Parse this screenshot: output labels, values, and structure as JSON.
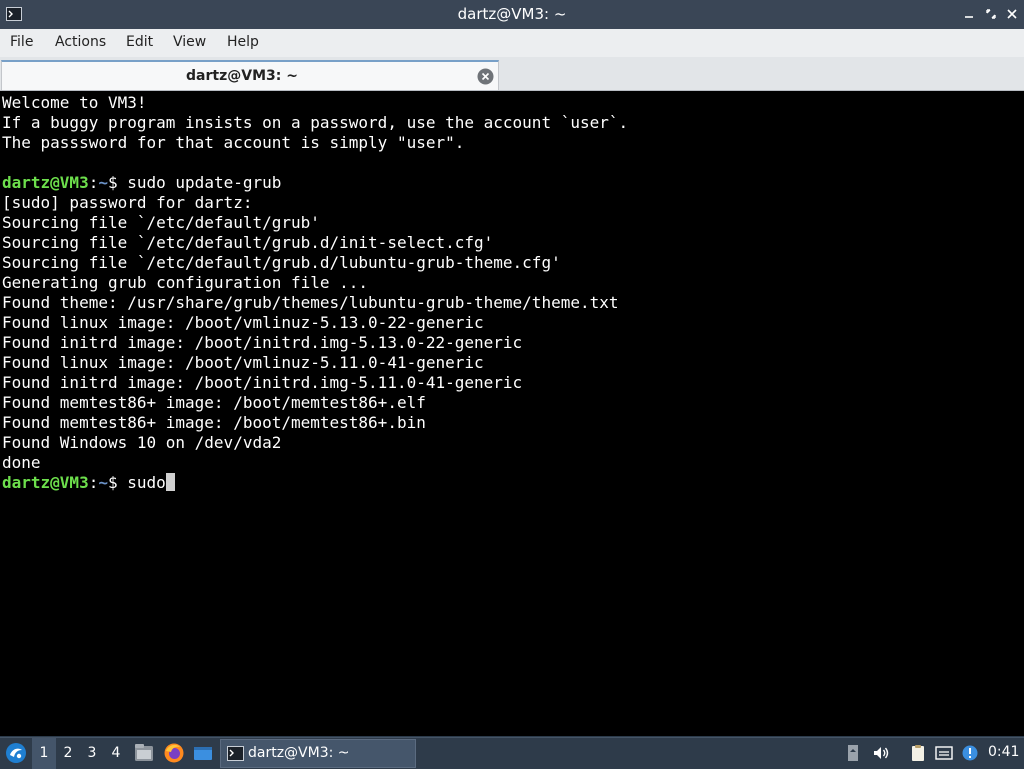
{
  "window": {
    "title": "dartz@VM3: ~"
  },
  "menu": [
    "File",
    "Actions",
    "Edit",
    "View",
    "Help"
  ],
  "tab": {
    "label": "dartz@VM3: ~"
  },
  "terminal": {
    "lines": [
      {
        "text": "Welcome to VM3!"
      },
      {
        "text": "If a buggy program insists on a password, use the account `user`."
      },
      {
        "text": "The passsword for that account is simply \"user\"."
      },
      {
        "text": ""
      },
      {
        "user": "dartz@VM3",
        "path": "~",
        "command": "sudo update-grub"
      },
      {
        "text": "[sudo] password for dartz:"
      },
      {
        "text": "Sourcing file `/etc/default/grub'"
      },
      {
        "text": "Sourcing file `/etc/default/grub.d/init-select.cfg'"
      },
      {
        "text": "Sourcing file `/etc/default/grub.d/lubuntu-grub-theme.cfg'"
      },
      {
        "text": "Generating grub configuration file ..."
      },
      {
        "text": "Found theme: /usr/share/grub/themes/lubuntu-grub-theme/theme.txt"
      },
      {
        "text": "Found linux image: /boot/vmlinuz-5.13.0-22-generic"
      },
      {
        "text": "Found initrd image: /boot/initrd.img-5.13.0-22-generic"
      },
      {
        "text": "Found linux image: /boot/vmlinuz-5.11.0-41-generic"
      },
      {
        "text": "Found initrd image: /boot/initrd.img-5.11.0-41-generic"
      },
      {
        "text": "Found memtest86+ image: /boot/memtest86+.elf"
      },
      {
        "text": "Found memtest86+ image: /boot/memtest86+.bin"
      },
      {
        "text": "Found Windows 10 on /dev/vda2"
      },
      {
        "text": "done"
      },
      {
        "user": "dartz@VM3",
        "path": "~",
        "command": "sudo",
        "cursor": true
      }
    ]
  },
  "taskbar": {
    "workspaces": [
      "1",
      "2",
      "3",
      "4"
    ],
    "active_workspace": "1",
    "task_label": "dartz@VM3: ~",
    "clock": "0:41"
  }
}
